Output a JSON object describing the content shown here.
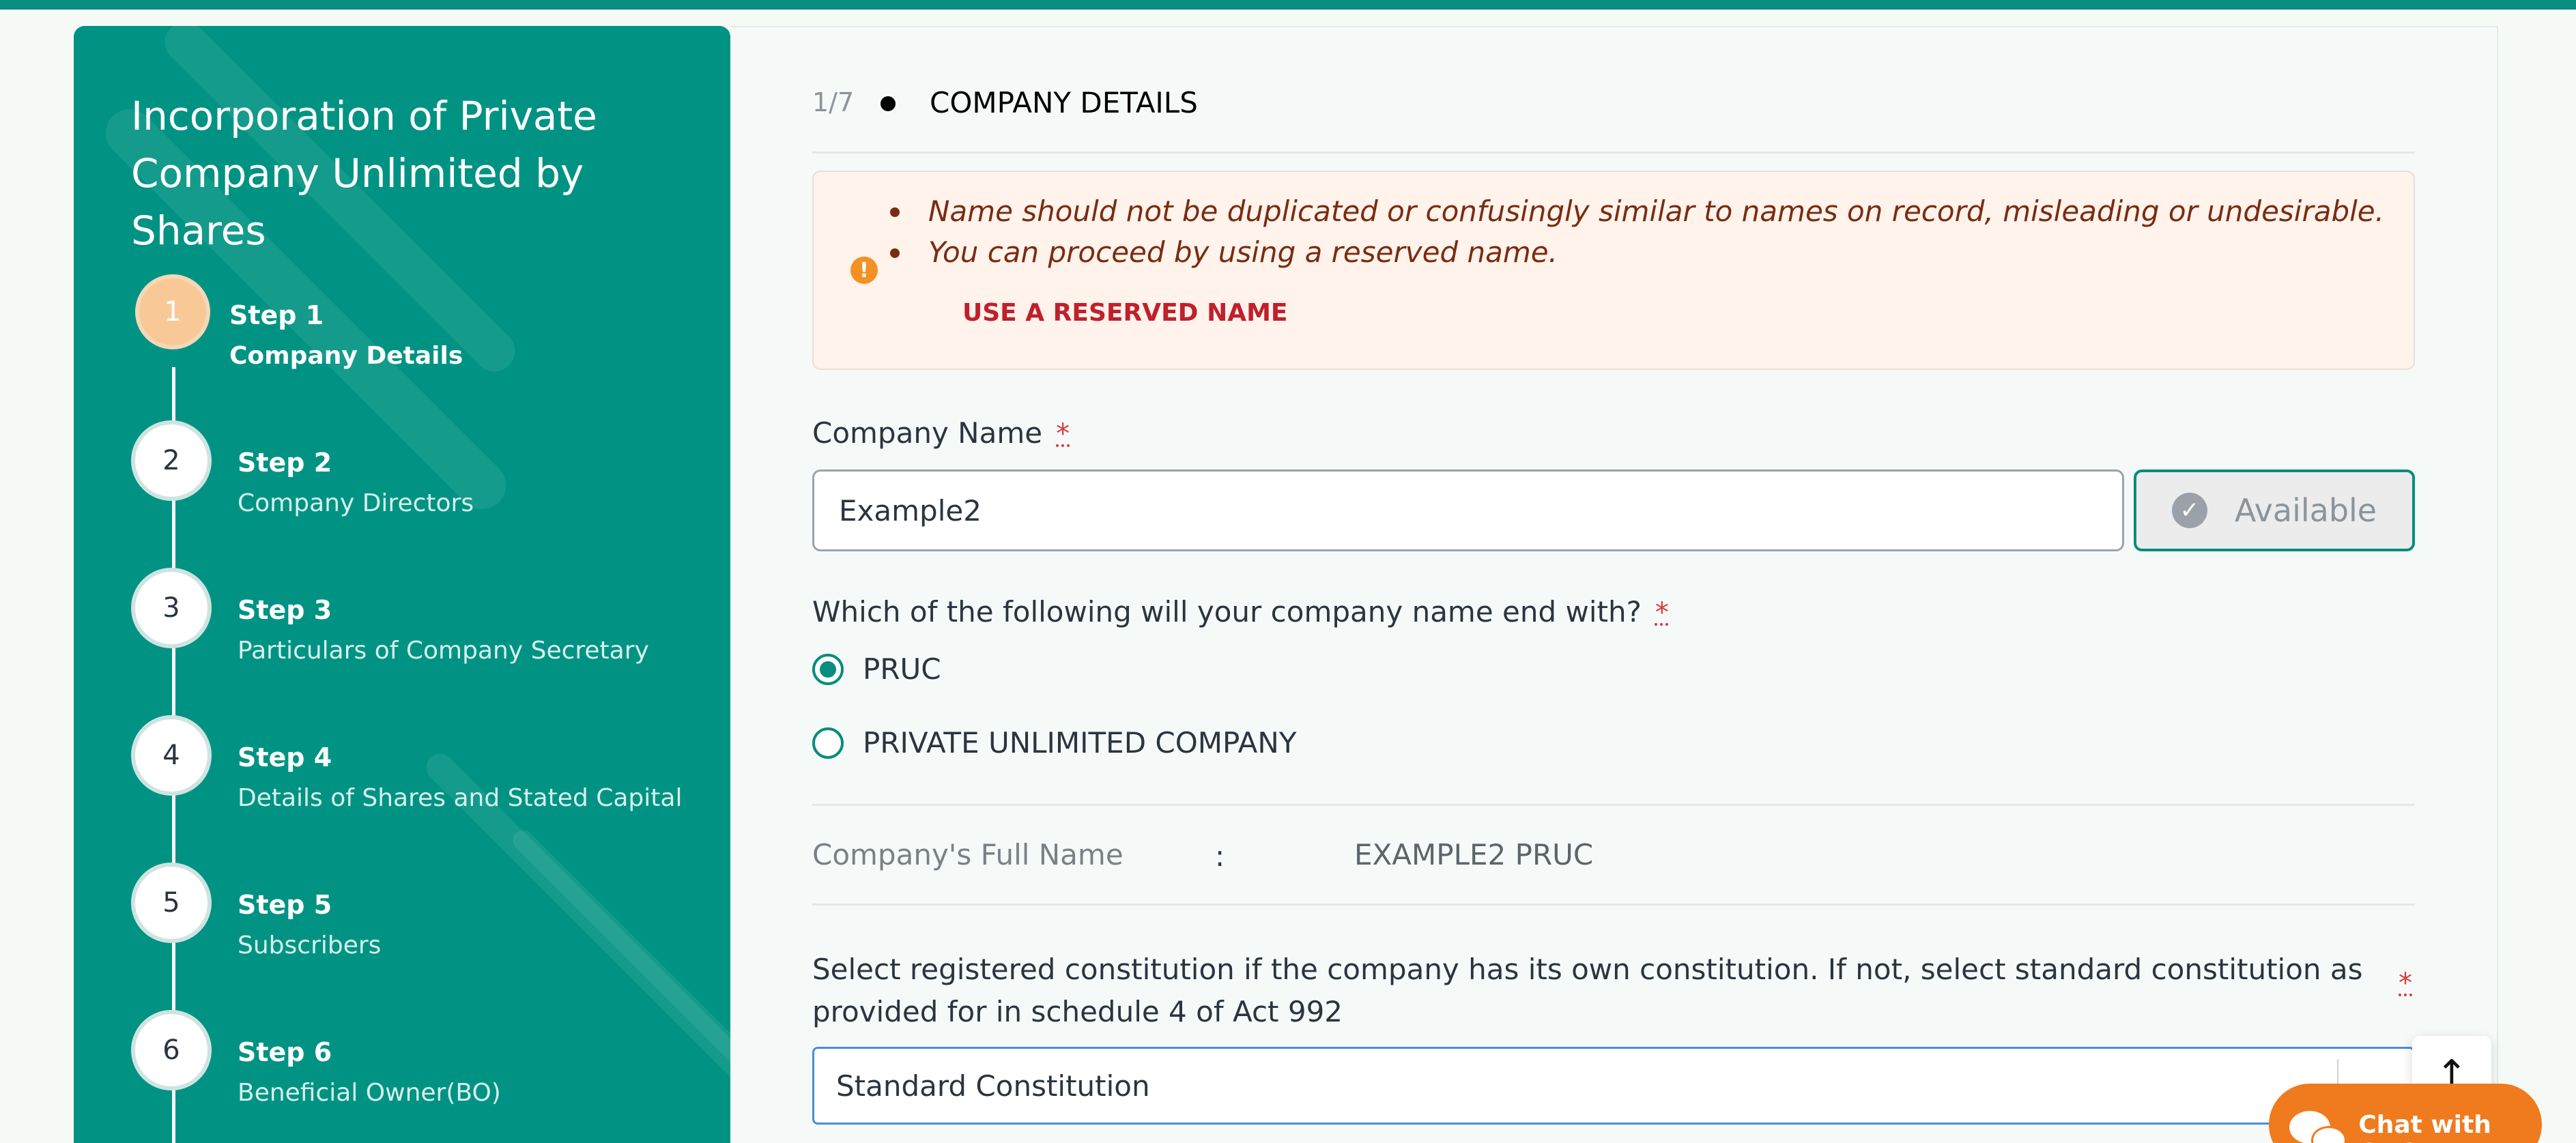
{
  "sidebar": {
    "title": "Incorporation of Private Company Unlimited by Shares",
    "steps": [
      {
        "num": "1",
        "title": "Step 1",
        "sub": "Company Details"
      },
      {
        "num": "2",
        "title": "Step 2",
        "sub": "Company Directors"
      },
      {
        "num": "3",
        "title": "Step 3",
        "sub": "Particulars of Company Secretary"
      },
      {
        "num": "4",
        "title": "Step 4",
        "sub": "Details of Shares and Stated Capital"
      },
      {
        "num": "5",
        "title": "Step 5",
        "sub": "Subscribers"
      },
      {
        "num": "6",
        "title": "Step 6",
        "sub": "Beneficial Owner(BO)"
      }
    ]
  },
  "main": {
    "progress": "1/7",
    "section_title": "COMPANY DETAILS",
    "notice": {
      "items": [
        "Name should not be duplicated or confusingly similar to names on record, misleading or undesirable.",
        "You can proceed by using a reserved name."
      ],
      "link": "USE A RESERVED NAME"
    },
    "company_name": {
      "label": "Company Name",
      "required": "*",
      "value": "Example2",
      "status": "Available"
    },
    "ending": {
      "label": "Which of the following will your company name end with?",
      "required": "*",
      "options": [
        "PRUC",
        "PRIVATE UNLIMITED COMPANY"
      ],
      "selected": "PRUC"
    },
    "full_name": {
      "label": "Company's Full Name",
      "colon": ":",
      "value": "EXAMPLE2 PRUC"
    },
    "constitution": {
      "label": "Select registered constitution if the company has its own constitution. If not, select standard constitution as provided for in schedule 4 of Act 992",
      "required": "*",
      "value": "Standard Constitution"
    }
  },
  "chat": {
    "label": "Chat with ORC"
  },
  "icons": {
    "scroll_top": "arrow-up-icon",
    "chat": "chat-bubbles-icon",
    "notice": "exclamation-icon",
    "status": "check-circle-icon"
  },
  "colors": {
    "primary": "#009383",
    "accent": "#f07a1e",
    "active_step": "#f8c997",
    "error": "#c0202c"
  }
}
